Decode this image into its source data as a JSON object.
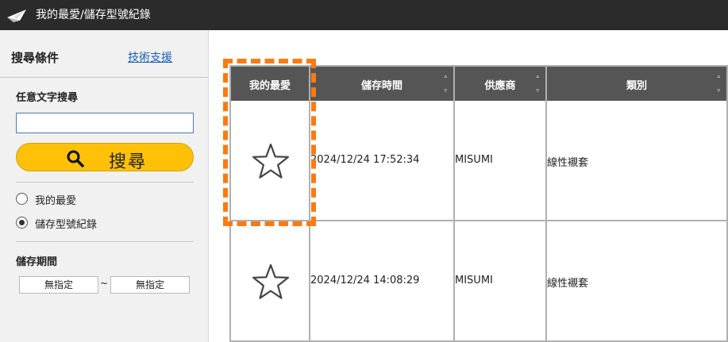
{
  "app": {
    "title": "我的最愛/儲存型號紀錄",
    "logo_icon": "paper-plane-logo-icon"
  },
  "sidebar": {
    "heading": "搜尋條件",
    "support_link": "技術支援",
    "keyword_label": "任意文字搜尋",
    "keyword_value": "",
    "search_button": "搜尋",
    "mode_options": [
      {
        "label": "我的最愛",
        "selected": false
      },
      {
        "label": "儲存型號紀錄",
        "selected": true
      }
    ],
    "period_label": "儲存期間",
    "period_from": "無指定",
    "period_separator": "~",
    "period_to": "無指定"
  },
  "table": {
    "columns": [
      "我的最愛",
      "儲存時間",
      "供應商",
      "類別"
    ],
    "sort_up_glyph": "▵",
    "sort_down_glyph": "▿",
    "rows": [
      {
        "favorite": false,
        "saved_at": "2024/12/24 17:52:34",
        "supplier": "MISUMI",
        "category": "線性襯套"
      },
      {
        "favorite": false,
        "saved_at": "2024/12/24 14:08:29",
        "supplier": "MISUMI",
        "category": "線性襯套"
      }
    ]
  },
  "colors": {
    "titlebar": "#2b2b2b",
    "search_button": "#ffc107",
    "header_bg": "#555555",
    "highlight": "#ff7a10",
    "link": "#1a5fb4"
  }
}
